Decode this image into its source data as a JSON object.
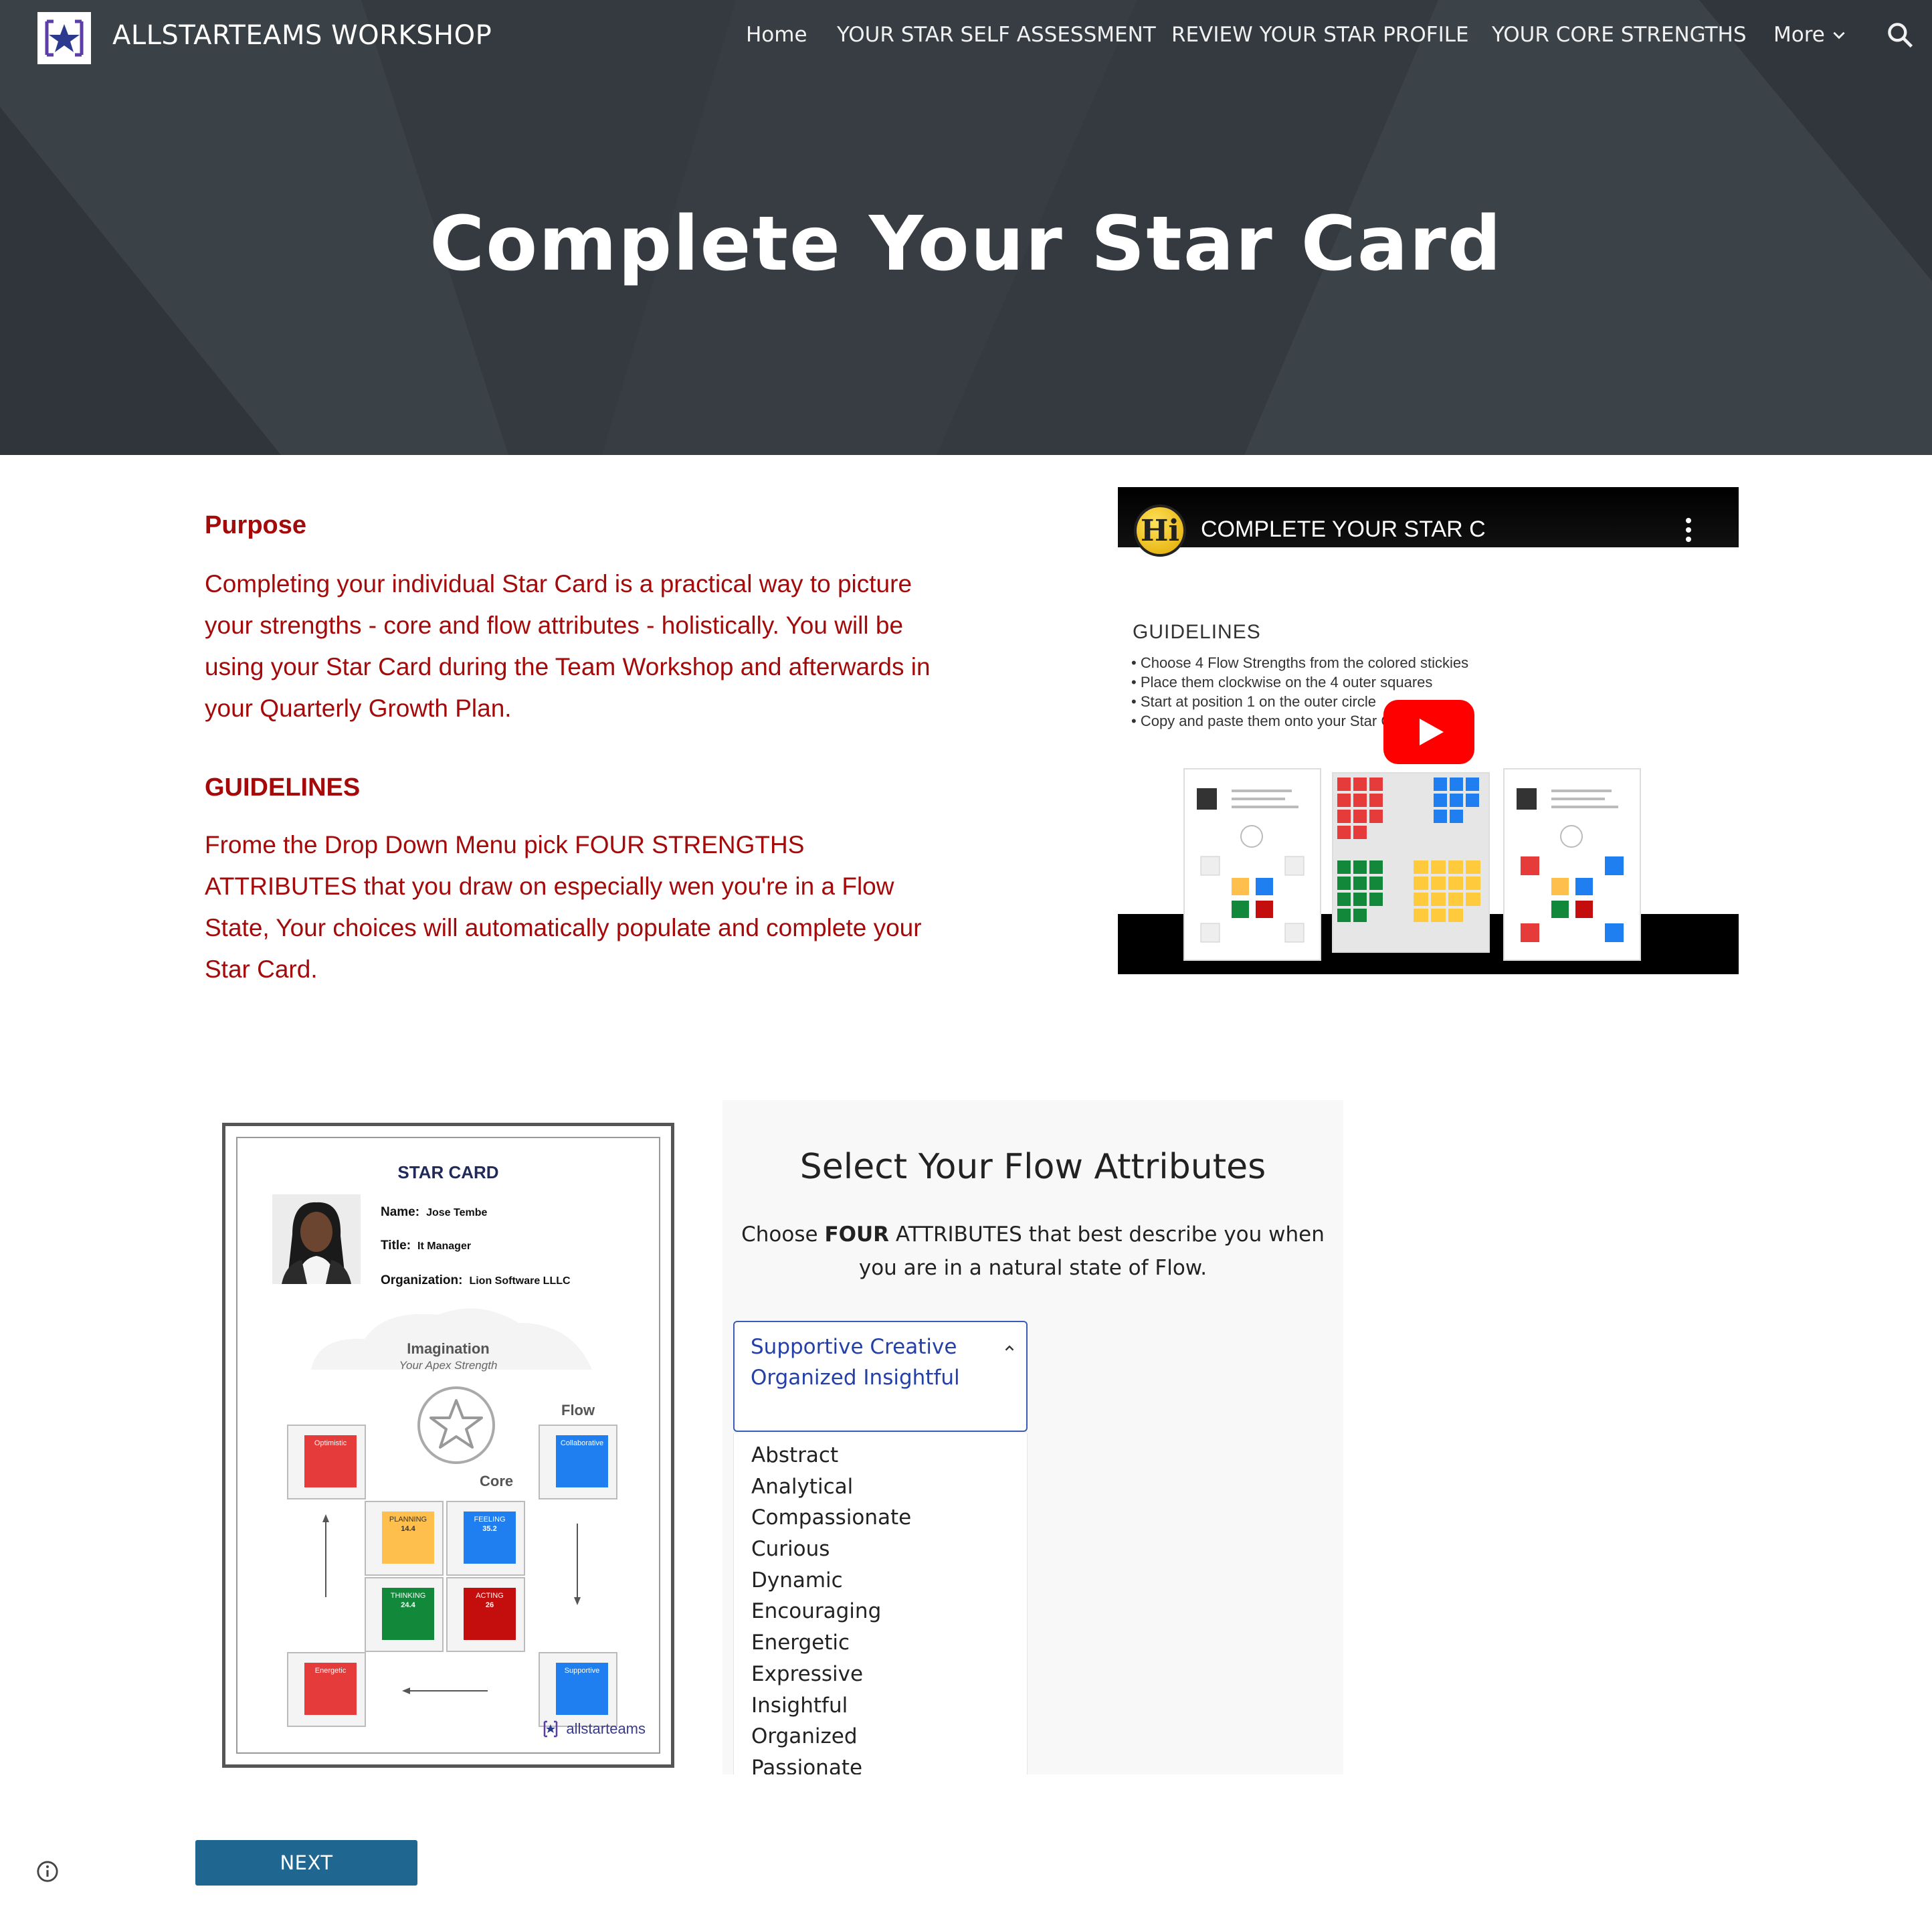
{
  "header": {
    "site_title": "ALLSTARTEAMS WORKSHOP",
    "nav": [
      {
        "label": "Home"
      },
      {
        "label": "YOUR STAR SELF ASSESSMENT"
      },
      {
        "label": "REVIEW YOUR STAR PROFILE"
      },
      {
        "label": "YOUR CORE STRENGTHS"
      },
      {
        "label": "More"
      }
    ],
    "icons": {
      "logo": "star-logo-icon",
      "search": "search-icon",
      "more": "chevron-down-icon"
    }
  },
  "hero": {
    "title": "Complete Your Star Card"
  },
  "content": {
    "purpose_heading": "Purpose",
    "purpose_text": "Completing  your individual Star Card is a practical way to  picture your strengths - core and flow attributes - holistically. You will be using your Star Card during the Team Workshop and afterwards in your Quarterly Growth Plan.",
    "guidelines_heading": "GUIDELINES",
    "guidelines_text": "Frome the Drop Down Menu pick FOUR STRENGTHS ATTRIBUTES that you draw on especially wen you're in a Flow State, Your choices will automatically populate and complete your Star Card.",
    "text_color": "#a40a0a"
  },
  "video": {
    "badge": "Hi",
    "title": "COMPLETE YOUR STAR C",
    "heading": "GUIDELINES",
    "bullets": [
      "• Choose 4 Flow Strengths from the colored stickies",
      "• Place them clockwise on the 4 outer squares",
      "• Start at position 1 on the outer circle",
      "• Copy and paste them onto your Star Card"
    ],
    "play_color": "#ff0000"
  },
  "star_card": {
    "title": "STAR CARD",
    "name_label": "Name:",
    "name_value": "Jose Tembe",
    "title_label": "Title:",
    "title_value": "It Manager",
    "org_label": "Organization:",
    "org_value": "Lion Software LLLC",
    "apex_label": "Imagination",
    "apex_sub": "Your Apex Strength",
    "flow_label": "Flow",
    "core_label": "Core",
    "flow_squares": [
      {
        "label": "Optimistic",
        "color": "#e63b3b"
      },
      {
        "label": "Collaborative",
        "color": "#1f7ff0"
      },
      {
        "label": "Supportive",
        "color": "#1f7ff0"
      },
      {
        "label": "Energetic",
        "color": "#e63b3b"
      }
    ],
    "core_squares": [
      {
        "label": "PLANNING",
        "value": "14.4",
        "color": "#ffbf4d"
      },
      {
        "label": "FEELING",
        "value": "35.2",
        "color": "#1f7ff0"
      },
      {
        "label": "THINKING",
        "value": "24.4",
        "color": "#12883a"
      },
      {
        "label": "ACTING",
        "value": "26",
        "color": "#c40d0d"
      }
    ],
    "brand": "allstarteams"
  },
  "selector": {
    "title": "Select Your Flow Attributes",
    "desc_pre": "Choose ",
    "desc_bold": "FOUR",
    "desc_post": " ATTRIBUTES that best describe you when you are in a natural state of Flow.",
    "selected_text": "Supportive  Creative Organized Insightful",
    "options": [
      "Abstract",
      "Analytical",
      "Compassionate",
      "Curious",
      "Dynamic",
      "Encouraging",
      "Energetic",
      "Expressive",
      "Insightful",
      "Organized",
      "Passionate"
    ],
    "accent_color": "#2440a6"
  },
  "footer": {
    "next_label": "NEXT",
    "info_icon": "info-icon"
  }
}
